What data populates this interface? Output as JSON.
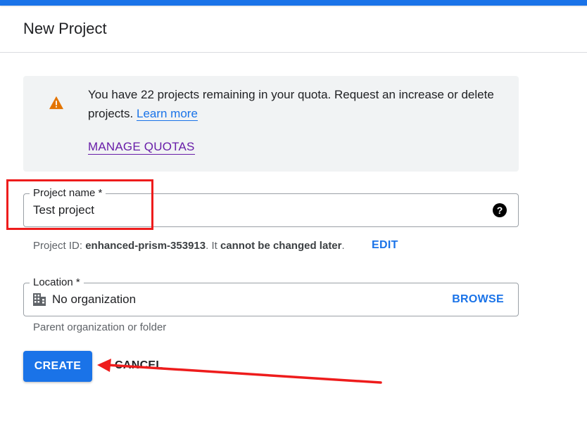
{
  "header": {
    "title": "New Project"
  },
  "quota_notice": {
    "icon": "warning-icon",
    "text_before_link": "You have 22 projects remaining in your quota. Request an increase or delete projects. ",
    "learn_more_label": "Learn more",
    "manage_quotas_label": "MANAGE QUOTAS"
  },
  "project_name": {
    "label": "Project name *",
    "value": "Test project",
    "help_icon_glyph": "?"
  },
  "project_id": {
    "prefix": "Project ID: ",
    "id": "enhanced-prism-353913",
    "mid": ". It ",
    "suffix_bold": "cannot be changed later",
    "end": ".",
    "edit_label": "EDIT"
  },
  "location": {
    "label": "Location *",
    "value": "No organization",
    "browse_label": "BROWSE",
    "hint": "Parent organization or folder"
  },
  "actions": {
    "create_label": "CREATE",
    "cancel_label": "CANCEL"
  },
  "colors": {
    "accent": "#1a73e8",
    "warning": "#e37400",
    "visited_link": "#681da8",
    "annotation": "#ee1c1c"
  }
}
